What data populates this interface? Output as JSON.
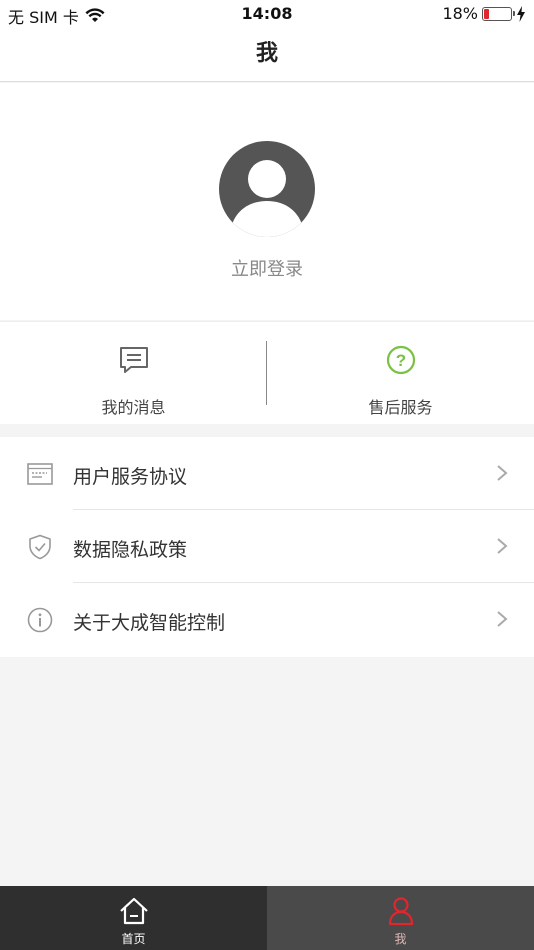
{
  "status_bar": {
    "carrier": "无 SIM 卡",
    "time": "14:08",
    "battery": "18%",
    "battery_level": 0.18
  },
  "nav": {
    "title": "我"
  },
  "profile": {
    "login_text": "立即登录"
  },
  "quick_actions": [
    {
      "label": "我的消息",
      "icon": "message-icon"
    },
    {
      "label": "售后服务",
      "icon": "help-circle-icon"
    }
  ],
  "menu": [
    {
      "label": "用户服务协议",
      "icon": "document-icon"
    },
    {
      "label": "数据隐私政策",
      "icon": "shield-check-icon"
    },
    {
      "label": "关于大成智能控制",
      "icon": "info-icon"
    }
  ],
  "tabs": [
    {
      "label": "首页",
      "icon": "home-icon"
    },
    {
      "label": "我",
      "icon": "person-icon"
    }
  ],
  "colors": {
    "accent_green": "#7ac143",
    "accent_red": "#e2262e",
    "tab_bar": "#2c2c2c"
  }
}
